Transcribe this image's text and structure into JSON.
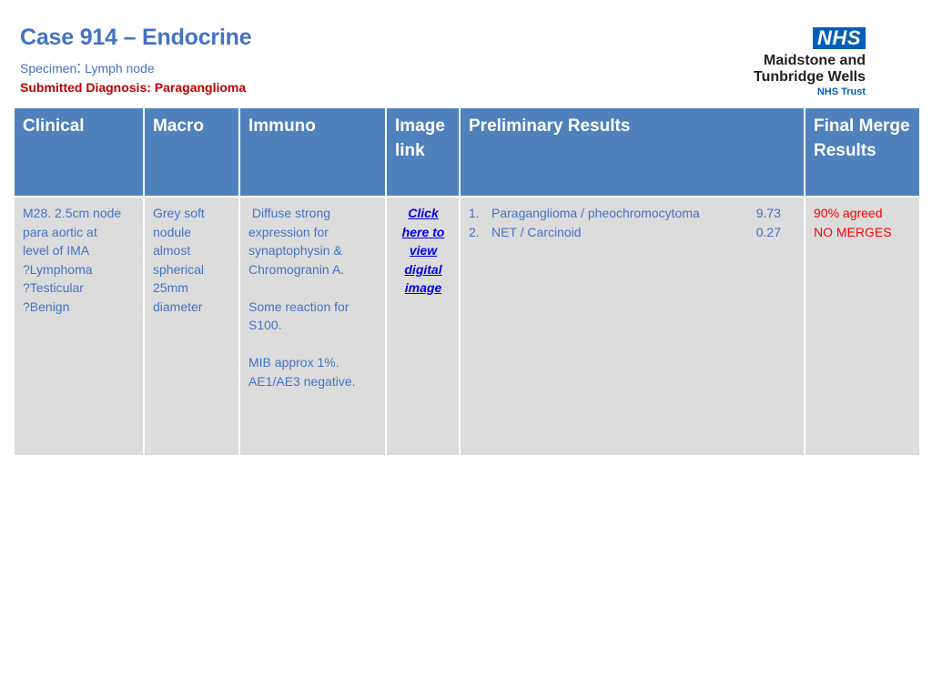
{
  "header": {
    "title": "Case 914 – Endocrine",
    "specimen_label": "Specimen",
    "specimen_colon": ":",
    "specimen_value": " Lymph node",
    "submitted_diagnosis": "Submitted Diagnosis: Paraganglioma"
  },
  "logo": {
    "badge": "NHS",
    "org_line1": "Maidstone and",
    "org_line2": "Tunbridge Wells",
    "org_sub": "NHS Trust",
    "badge_color": "#005eb8"
  },
  "table": {
    "headers": {
      "clinical": "Clinical",
      "macro": "Macro",
      "immuno": "Immuno",
      "image_link": "Image link",
      "preliminary": "Preliminary Results",
      "final": "Final Merge Results"
    },
    "row": {
      "clinical": [
        "M28. 2.5cm node",
        "para aortic at",
        "level of IMA",
        "?Lymphoma",
        "?Testicular",
        "?Benign"
      ],
      "macro": [
        "Grey soft",
        "nodule",
        "almost",
        "spherical",
        "25mm",
        "diameter"
      ],
      "immuno": {
        "para1": " Diffuse strong expression for synaptophysin & Chromogranin A.",
        "para2": "Some reaction for S100.",
        "para3": "MIB approx 1%. AE1/AE3 negative."
      },
      "image_link": [
        "Click",
        "here to",
        "view",
        "digital",
        "image"
      ],
      "preliminary": [
        {
          "num": "1.",
          "label": "Paraganglioma / pheochromocytoma",
          "score": "9.73"
        },
        {
          "num": "2.",
          "label": "NET / Carcinoid",
          "score": "0.27"
        }
      ],
      "final": [
        "90% agreed",
        "NO MERGES"
      ]
    }
  },
  "colors": {
    "header_bg": "#4f81bd",
    "cell_bg": "#dcdcdc",
    "text_blue": "#4472c4",
    "text_red": "#ff0000",
    "diagnosis_red": "#c00000"
  }
}
